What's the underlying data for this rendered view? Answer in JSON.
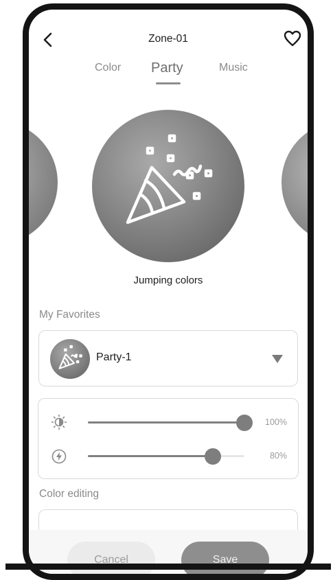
{
  "header": {
    "title": "Zone-01",
    "back_icon": "chevron-left-icon",
    "favorite_icon": "heart-outline-icon"
  },
  "tabs": [
    {
      "label": "Color",
      "active": false
    },
    {
      "label": "Party",
      "active": true
    },
    {
      "label": "Music",
      "active": false
    }
  ],
  "carousel": {
    "selected_label": "Jumping colors",
    "selected_icon": "party-popper-icon"
  },
  "favorites": {
    "section_label": "My Favorites",
    "selected": "Party-1",
    "thumb_icon": "party-popper-icon",
    "dropdown_icon": "triangle-down-icon"
  },
  "sliders": [
    {
      "name": "brightness",
      "icon": "brightness-icon",
      "value_label": "100%",
      "value": 1.0
    },
    {
      "name": "speed",
      "icon": "bolt-circle-icon",
      "value_label": "80%",
      "value": 0.8
    }
  ],
  "color_editing": {
    "section_label": "Color editing"
  },
  "footer": {
    "cancel_label": "Cancel",
    "save_label": "Save"
  }
}
